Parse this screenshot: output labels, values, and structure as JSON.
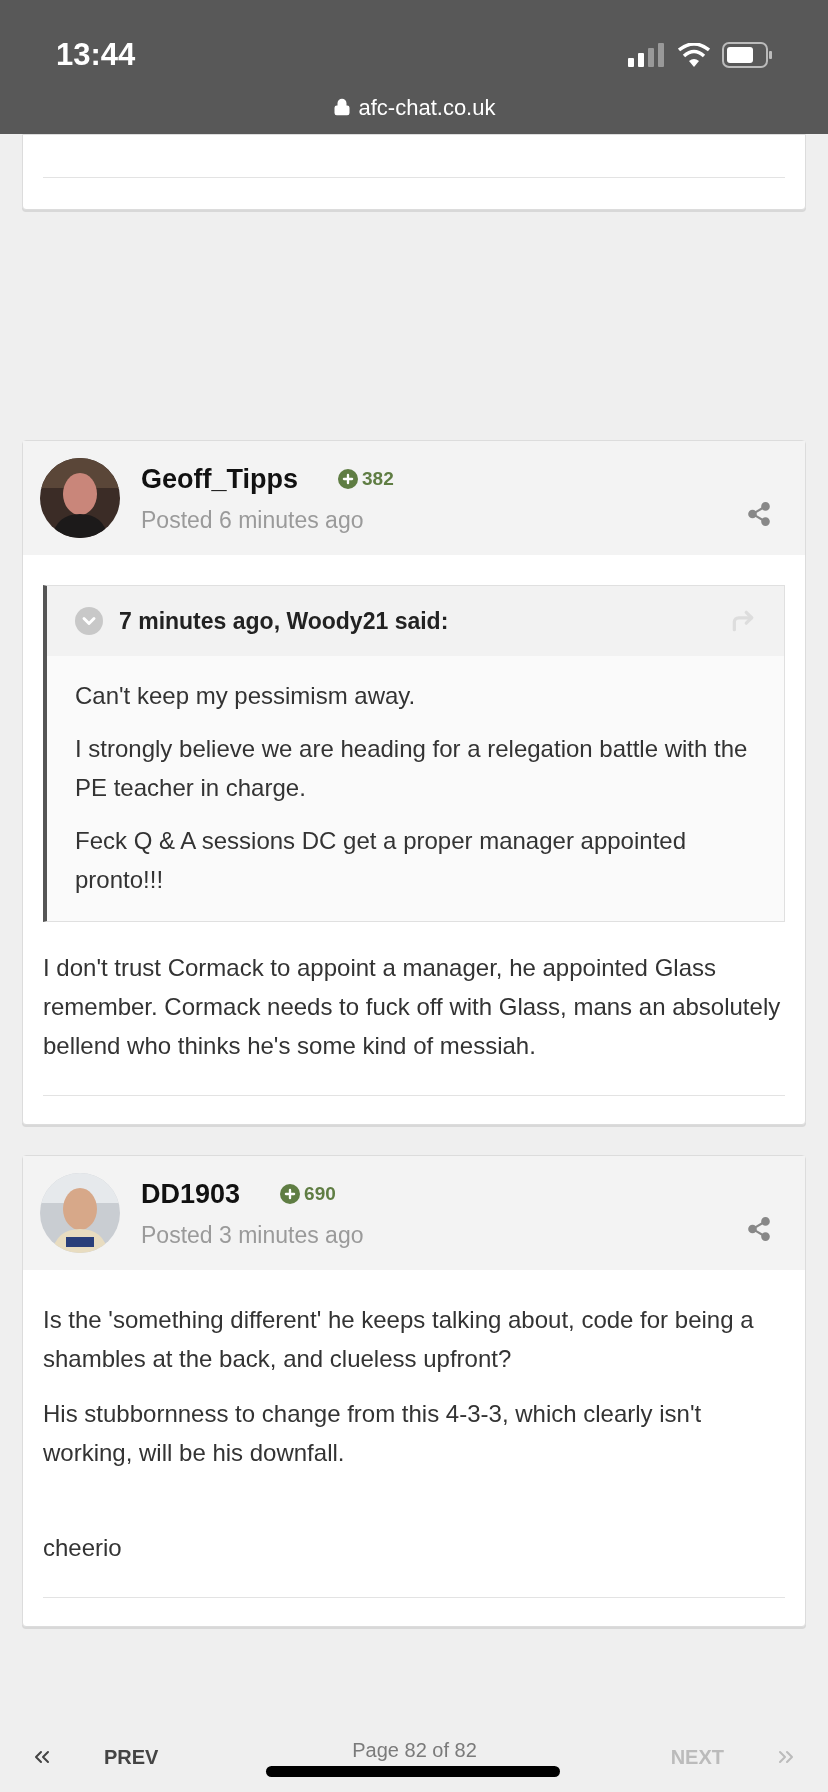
{
  "status_bar": {
    "time": "13:44"
  },
  "address_bar": {
    "url": "afc-chat.co.uk"
  },
  "posts": [
    {
      "author": "Geoff_Tipps",
      "reputation": "382",
      "posted": "Posted 6 minutes ago",
      "quote": {
        "header": "7 minutes ago, Woody21 said:",
        "paragraphs": [
          "Can't keep my pessimism away.",
          "I strongly believe we are heading for a relegation battle with the PE teacher in charge.",
          "Feck Q & A sessions DC get a proper manager appointed pronto!!!"
        ]
      },
      "paragraphs": [
        "I don't trust Cormack to appoint a manager, he appointed Glass remember. Cormack needs to fuck off with Glass, mans an absolutely bellend who thinks he's some kind of messiah."
      ]
    },
    {
      "author": "DD1903",
      "reputation": "690",
      "posted": "Posted 3 minutes ago",
      "paragraphs": [
        "Is the 'something different' he keeps talking about, code for being a shambles at the back, and clueless upfront?",
        "His stubbornness to change from this 4-3-3, which clearly isn't working, will be his downfall."
      ],
      "signature": "cheerio"
    }
  ],
  "pagination": {
    "prev": {
      "label": "PREV",
      "disabled": false
    },
    "page": "Page 82 of 82",
    "next": {
      "label": "NEXT",
      "disabled": true
    }
  }
}
